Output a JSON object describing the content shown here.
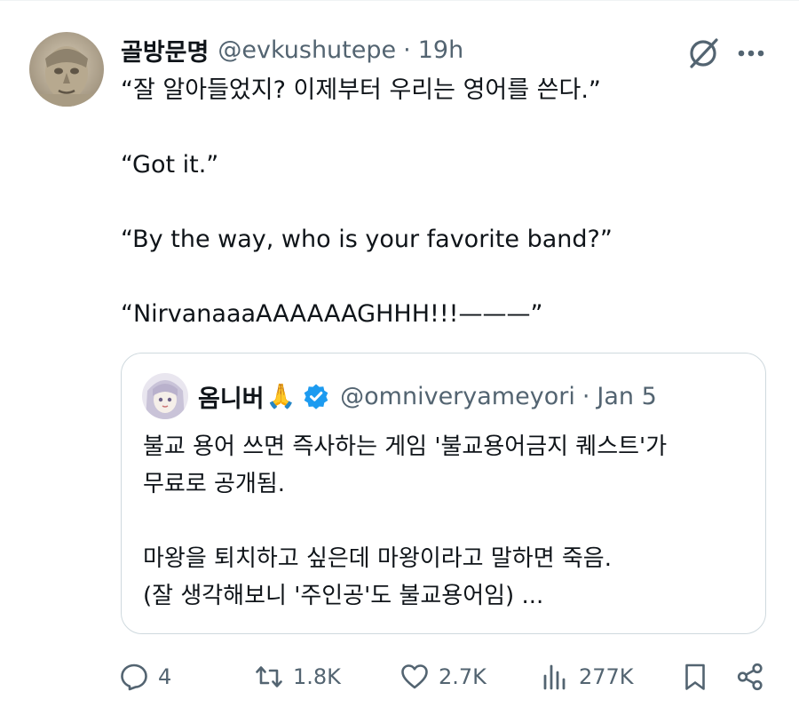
{
  "tweet": {
    "display_name": "골방문명",
    "handle": "@evkushutepe",
    "separator": "·",
    "time": "19h",
    "avatar_icon": "stone-head-avatar",
    "lines": [
      "“잘 알아들었지? 이제부터 우리는 영어를 쓴다.”",
      "“Got it.”",
      "“By the way, who is your favorite band?”",
      "“NirvanaaaAAAAAAGHHH!!!———”"
    ]
  },
  "quote": {
    "display_name": "옴니버",
    "emoji": "🙏",
    "handle": "@omniveryameyori",
    "separator": "·",
    "time": "Jan 5",
    "lines": [
      "불교 용어 쓰면 즉사하는 게임 '불교용어금지 퀘스트'가",
      "무료로 공개됨.",
      "마왕을 퇴치하고 싶은데 마왕이라고 말하면 죽음.",
      "(잘 생각해보니 '주인공'도 불교용어임) ..."
    ]
  },
  "actions": {
    "replies": "4",
    "reposts": "1.8K",
    "likes": "2.7K",
    "views": "277K"
  },
  "colors": {
    "text": "#0f1419",
    "muted": "#536471",
    "border": "#cfd9de",
    "verified": "#1d9bf0"
  }
}
